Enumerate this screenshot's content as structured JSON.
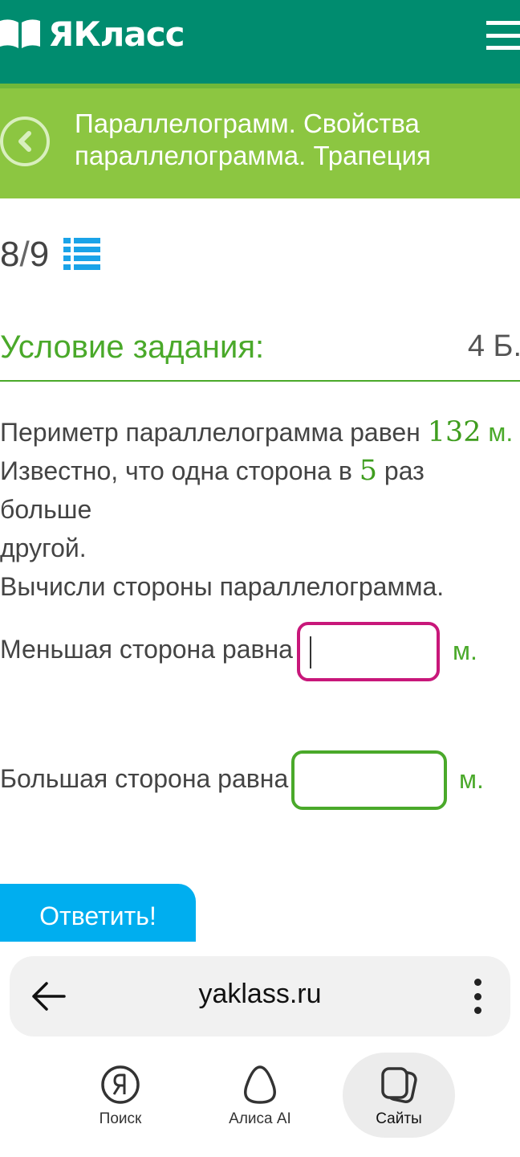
{
  "header": {
    "logo_text": "ЯКласс",
    "menu_icon": "hamburger-menu-icon",
    "colors": {
      "header_bg": "#008c6f",
      "topic_bg": "#8cc641"
    }
  },
  "topic": {
    "back_icon": "chevron-left-circle-icon",
    "title": "Параллелограмм. Свойства параллелограмма. Трапеция"
  },
  "progress": {
    "current": "8",
    "separator": "/",
    "total": "9",
    "list_icon": "task-list-icon"
  },
  "task": {
    "condition_title": "Условие задания:",
    "points": "4 Б.",
    "line1_prefix": "Периметр параллелограмма равен ",
    "perimeter": "132",
    "unit_m": " м.",
    "line2_prefix": "Известно, что одна сторона в ",
    "ratio": "5",
    "line2_suffix": " раз больше",
    "line3": "другой.",
    "line4": "Вычисли стороны параллелограмма."
  },
  "answers": {
    "smaller_label": "Меньшая сторона равна",
    "smaller_value": "",
    "smaller_unit": "м.",
    "larger_label": "Большая сторона равна",
    "larger_value": "",
    "larger_unit": "м."
  },
  "submit_label": "Ответить!",
  "browser": {
    "back_icon": "arrow-left-icon",
    "url": "yaklass.ru",
    "menu_icon": "vertical-dots-icon",
    "nav": [
      {
        "label": "Поиск",
        "icon": "yandex-search-icon"
      },
      {
        "label": "Алиса AI",
        "icon": "alice-icon"
      },
      {
        "label": "Сайты",
        "icon": "tabs-icon"
      }
    ]
  }
}
